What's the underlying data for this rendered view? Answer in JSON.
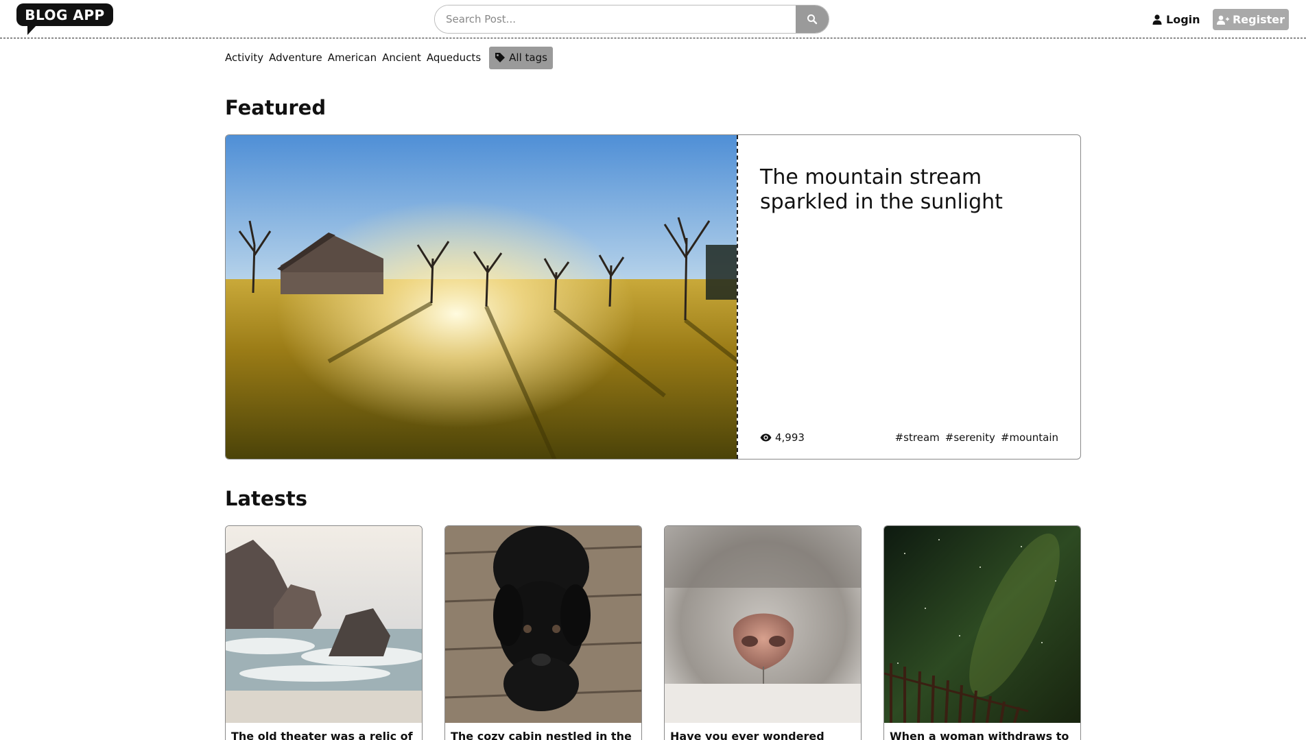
{
  "header": {
    "logo": "BLOG APP",
    "search_placeholder": "Search Post...",
    "login_label": "Login",
    "register_label": "Register"
  },
  "tags": {
    "items": [
      "Activity",
      "Adventure",
      "American",
      "Ancient",
      "Aqueducts"
    ],
    "all_label": "All tags"
  },
  "featured": {
    "section_title": "Featured",
    "title": "The mountain stream sparkled in the sunlight",
    "views": "4,993",
    "hashtags": [
      "#stream",
      "#serenity",
      "#mountain"
    ]
  },
  "latests": {
    "section_title": "Latests",
    "cards": [
      {
        "title": "The old theater was a relic of a",
        "image": "sea-rocks-waves"
      },
      {
        "title": "The cozy cabin nestled in the",
        "image": "black-puppy-on-wood"
      },
      {
        "title": "Have you ever wondered about",
        "image": "animal-nose-closeup"
      },
      {
        "title": "When a woman withdraws to give",
        "image": "night-sky-milky-way-fence"
      }
    ]
  },
  "colors": {
    "logo_bg": "#111111",
    "search_button": "#9a9a9a",
    "register_bg": "#a9a9a9",
    "tag_all_bg": "#9a9a9a"
  }
}
